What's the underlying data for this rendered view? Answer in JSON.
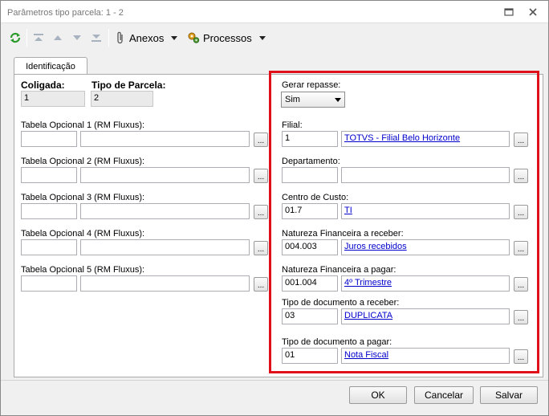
{
  "window": {
    "title": "Parâmetros tipo parcela: 1 - 2"
  },
  "toolbar": {
    "anexos_label": "Anexos",
    "processos_label": "Processos"
  },
  "tabs": [
    {
      "label": "Identificação"
    }
  ],
  "left": {
    "coligada_label": "Coligada:",
    "coligada_value": "1",
    "tipo_parcela_label": "Tipo de Parcela:",
    "tipo_parcela_value": "2",
    "tabelas": [
      {
        "label": "Tabela Opcional 1 (RM Fluxus):",
        "code": "",
        "desc": ""
      },
      {
        "label": "Tabela Opcional 2 (RM Fluxus):",
        "code": "",
        "desc": ""
      },
      {
        "label": "Tabela Opcional 3 (RM Fluxus):",
        "code": "",
        "desc": ""
      },
      {
        "label": "Tabela Opcional 4 (RM Fluxus):",
        "code": "",
        "desc": ""
      },
      {
        "label": "Tabela Opcional 5 (RM Fluxus):",
        "code": "",
        "desc": ""
      }
    ]
  },
  "right": {
    "gerar_repasse_label": "Gerar repasse:",
    "gerar_repasse_value": "Sim",
    "fields": [
      {
        "label": "Filial:",
        "code": "1",
        "desc": "TOTVS - Filial Belo Horizonte"
      },
      {
        "label": "Departamento:",
        "code": "",
        "desc": ""
      },
      {
        "label": "Centro de Custo:",
        "code": "01.7",
        "desc": "TI"
      },
      {
        "label": "Natureza Financeira a receber:",
        "code": "004.003",
        "desc": "Juros recebidos"
      },
      {
        "label": "Natureza Financeira a pagar:",
        "code": "001.004",
        "desc": "4º Trimestre"
      },
      {
        "label": "Tipo de documento a receber:",
        "code": "03",
        "desc": "DUPLICATA"
      },
      {
        "label": "Tipo de documento a pagar:",
        "code": "01",
        "desc": "Nota Fiscal"
      }
    ]
  },
  "lookup_label": "...",
  "buttons": {
    "ok": "OK",
    "cancelar": "Cancelar",
    "salvar": "Salvar"
  },
  "colors": {
    "highlight": "#e0101a",
    "link": "#0000cc"
  }
}
